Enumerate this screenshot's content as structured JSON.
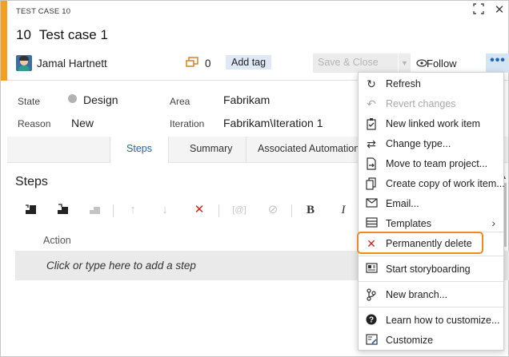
{
  "header": {
    "work_item_type": "TEST CASE 10",
    "id": "10",
    "title": "Test case 1",
    "assigned_to": "Jamal Hartnett",
    "comment_count": "0",
    "add_tag_label": "Add tag",
    "save_close_label": "Save & Close",
    "follow_label": "Follow",
    "more_label": "•••",
    "accent_color": "#f2a01e"
  },
  "fields": {
    "state_label": "State",
    "state_value": "Design",
    "reason_label": "Reason",
    "reason_value": "New",
    "area_label": "Area",
    "area_value": "Fabrikam",
    "iteration_label": "Iteration",
    "iteration_value": "Fabrikam\\Iteration 1"
  },
  "tabs": [
    {
      "label": "Steps",
      "active": true
    },
    {
      "label": "Summary",
      "active": false
    },
    {
      "label": "Associated Automation",
      "active": false
    }
  ],
  "steps": {
    "title": "Steps",
    "action_header": "Action",
    "add_step_placeholder": "Click or type here to add a step"
  },
  "menu": {
    "items": [
      {
        "label": "Refresh",
        "icon": "refresh-icon",
        "disabled": false
      },
      {
        "label": "Revert changes",
        "icon": "revert-icon",
        "disabled": true
      },
      {
        "label": "New linked work item",
        "icon": "linked-item-icon",
        "disabled": false
      },
      {
        "label": "Change type...",
        "icon": "change-type-icon",
        "disabled": false
      },
      {
        "label": "Move to team project...",
        "icon": "move-icon",
        "disabled": false
      },
      {
        "label": "Create copy of work item...",
        "icon": "copy-icon",
        "disabled": false
      },
      {
        "label": "Email...",
        "icon": "email-icon",
        "disabled": false
      },
      {
        "label": "Templates",
        "icon": "templates-icon",
        "disabled": false,
        "submenu": true
      },
      {
        "label": "Permanently delete",
        "icon": "delete-icon",
        "disabled": false,
        "highlighted": true
      },
      {
        "label": "Start storyboarding",
        "icon": "storyboard-icon",
        "disabled": false
      },
      {
        "label": "New branch...",
        "icon": "branch-icon",
        "disabled": false
      },
      {
        "label": "Learn how to customize...",
        "icon": "help-icon",
        "disabled": false
      },
      {
        "label": "Customize",
        "icon": "customize-icon",
        "disabled": false
      }
    ],
    "highlight_color": "#f08a1c",
    "delete_icon_color": "#d9201a"
  }
}
